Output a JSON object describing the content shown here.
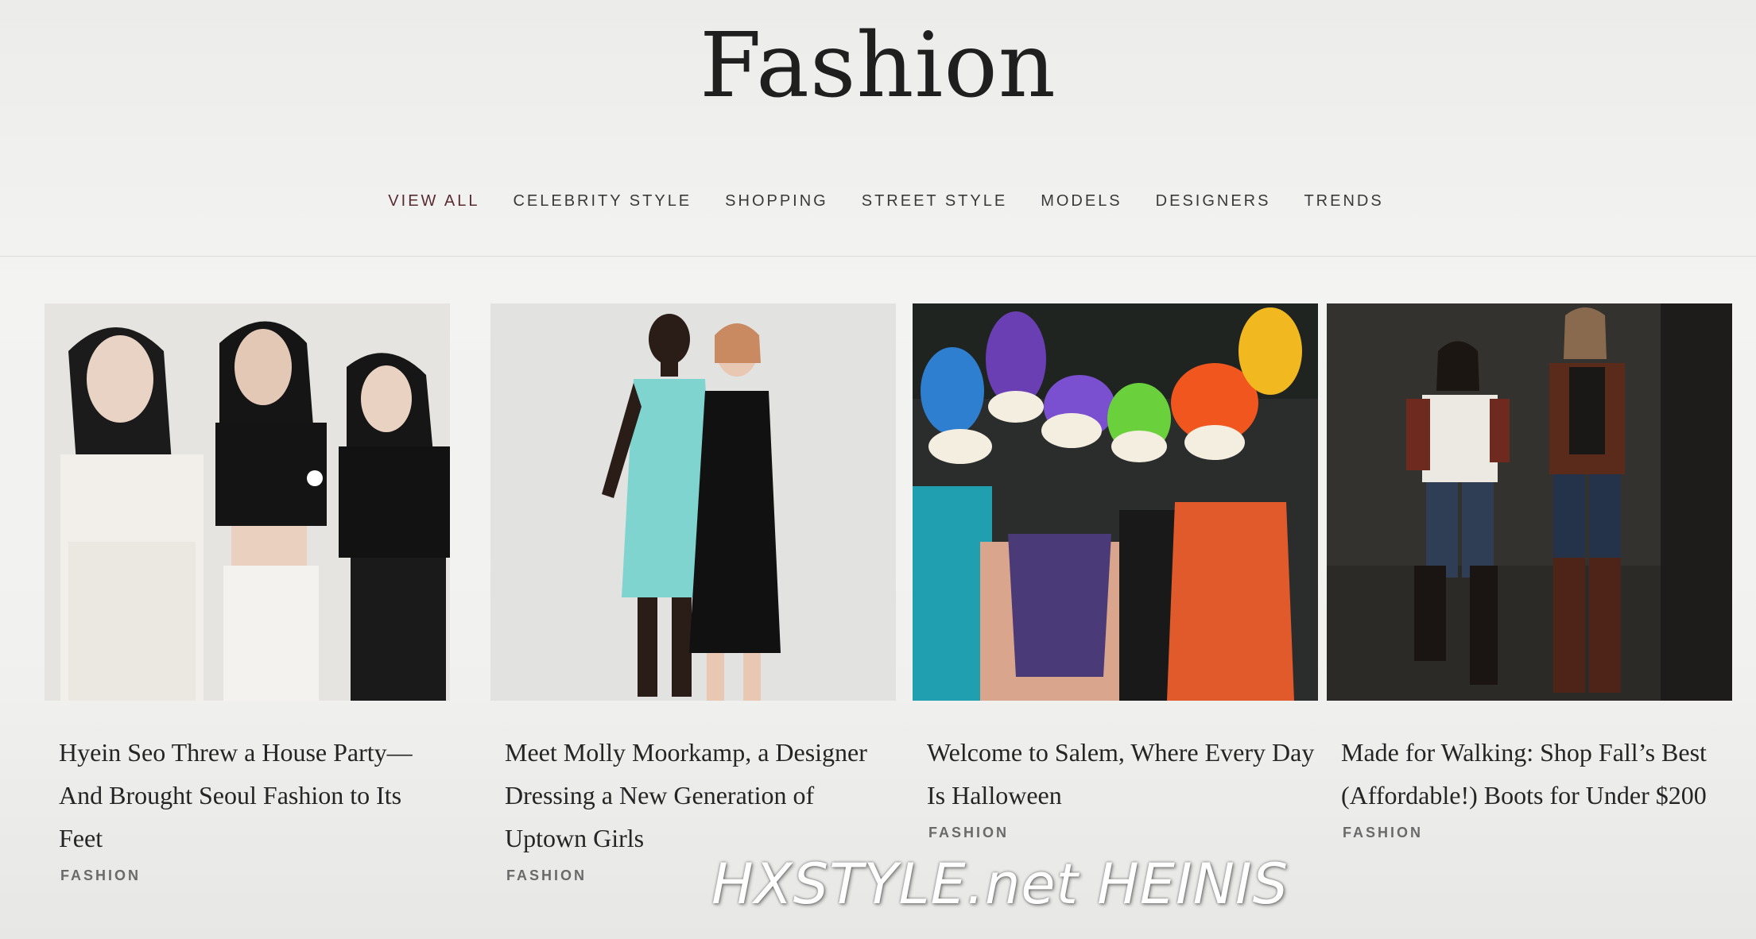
{
  "header": {
    "title": "Fashion"
  },
  "nav": {
    "items": [
      {
        "label": "VIEW ALL",
        "active": true
      },
      {
        "label": "CELEBRITY STYLE"
      },
      {
        "label": "SHOPPING"
      },
      {
        "label": "STREET STYLE"
      },
      {
        "label": "MODELS"
      },
      {
        "label": "DESIGNERS"
      },
      {
        "label": "TRENDS"
      }
    ]
  },
  "articles": [
    {
      "title": "Hyein Seo Threw a House Party—And Brought Seoul Fashion to Its Feet",
      "tag": "FASHION"
    },
    {
      "title": "Meet Molly Moorkamp, a Designer Dressing a New Generation of Uptown Girls",
      "tag": "FASHION"
    },
    {
      "title": "Welcome to Salem, Where Every Day Is Halloween",
      "tag": "FASHION"
    },
    {
      "title": "Made for Walking: Shop Fall’s Best (Affordable!) Boots for Under $200",
      "tag": "FASHION"
    }
  ],
  "watermark": "HXSTYLE.net HEINIS",
  "colors": {
    "background": "#f1f1ef",
    "active_nav": "#5a2a33",
    "text": "#252525",
    "tag": "#6a6a6a"
  }
}
